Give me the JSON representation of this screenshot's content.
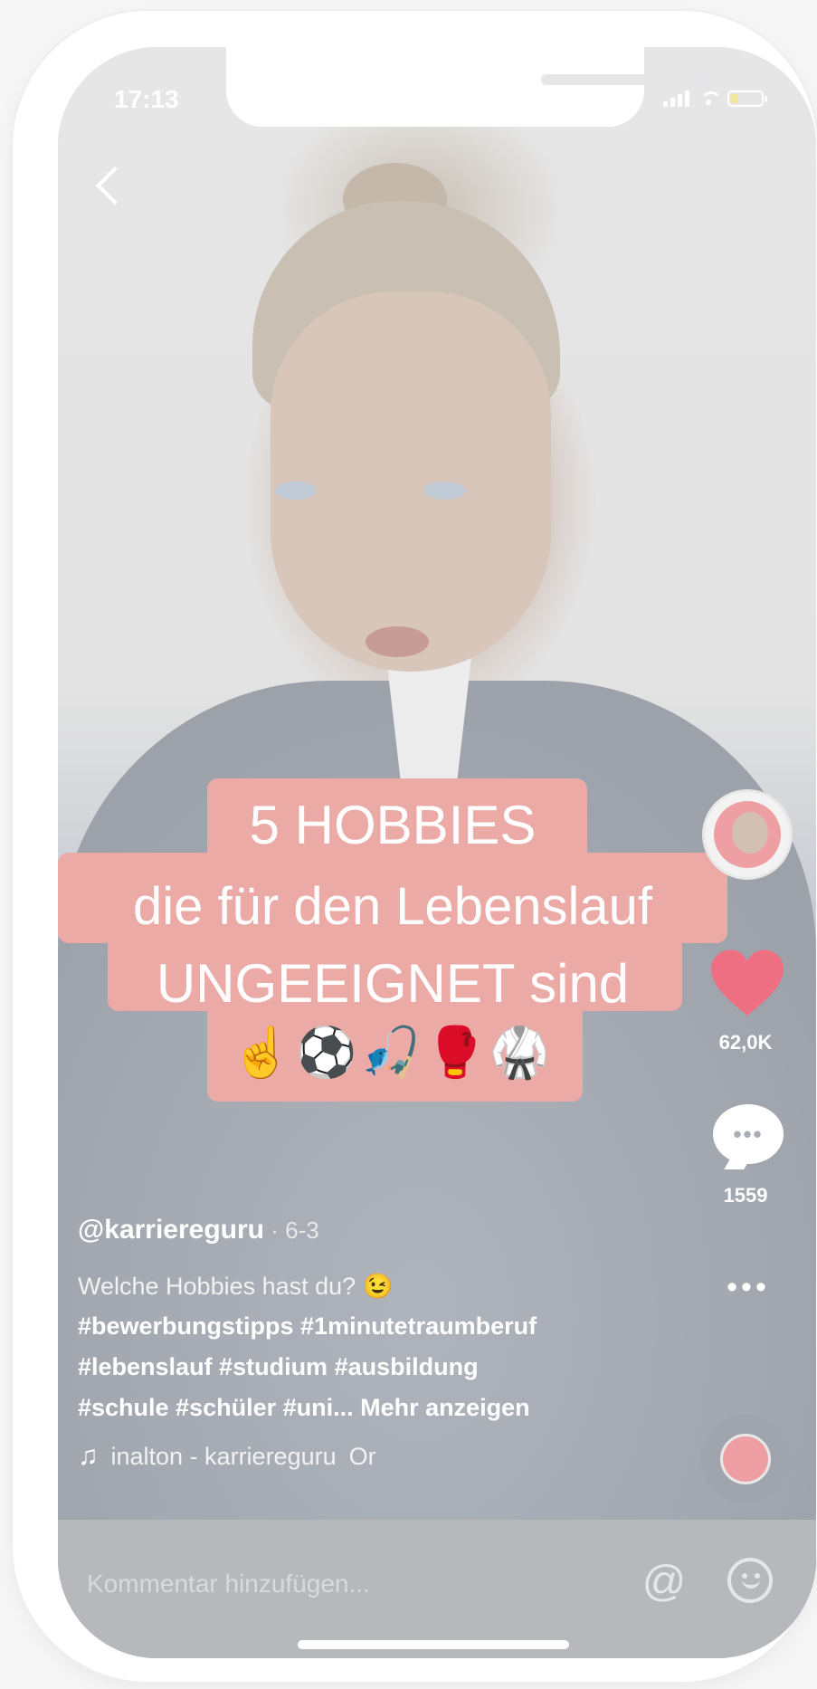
{
  "status_bar": {
    "time": "17:13"
  },
  "video_overlay": {
    "line1": "5 HOBBIES",
    "line2": "die für den Lebenslauf",
    "line3": "UNGEEIGNET sind",
    "emojis": "☝️⚽🎣🥊🥋"
  },
  "actions": {
    "likes": "62,0K",
    "comments": "1559",
    "more": "•••"
  },
  "caption": {
    "username": "@karriereguru",
    "date": " · 6-3",
    "text_line1": "Welche Hobbies hast du? 😉",
    "text_line2": "#bewerbungstipps #1minutetraumberuf",
    "text_line3": "#lebenslauf #studium #ausbildung",
    "text_line4": "#schule #schüler #uni...",
    "more_label": "Mehr anzeigen"
  },
  "sound": {
    "note": "♫",
    "text": "inalton - karriereguru",
    "text_suffix": "Or"
  },
  "comment_bar": {
    "placeholder": "Kommentar hinzufügen...",
    "at_symbol": "@"
  }
}
